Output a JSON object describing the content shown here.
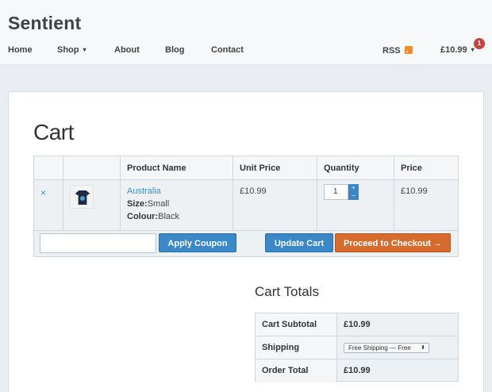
{
  "site": {
    "logo": "Sentient"
  },
  "nav": {
    "items": [
      {
        "label": "Home"
      },
      {
        "label": "Shop",
        "has_dropdown": true
      },
      {
        "label": "About"
      },
      {
        "label": "Blog"
      },
      {
        "label": "Contact"
      }
    ],
    "rss_label": "RSS",
    "cart_total": "£10.99",
    "cart_count": "1"
  },
  "page": {
    "title": "Cart"
  },
  "cart": {
    "columns": [
      "",
      "",
      "Product Name",
      "Unit Price",
      "Quantity",
      "Price"
    ],
    "items": [
      {
        "remove_symbol": "×",
        "product_name": "Australia",
        "size_label": "Size:",
        "size_value": "Small",
        "colour_label": "Colour:",
        "colour_value": "Black",
        "unit_price": "£10.99",
        "quantity": "1",
        "price": "£10.99"
      }
    ],
    "qty_up": "+",
    "qty_down": "−",
    "coupon_placeholder": "",
    "apply_coupon_label": "Apply Coupon",
    "update_cart_label": "Update Cart",
    "checkout_label": "Proceed to Checkout →"
  },
  "totals": {
    "title": "Cart Totals",
    "rows": [
      {
        "label": "Cart Subtotal",
        "value": "£10.99"
      },
      {
        "label": "Shipping",
        "value": "Free Shipping — Free"
      },
      {
        "label": "Order Total",
        "value": "£10.99"
      }
    ]
  },
  "colors": {
    "accent": "#3a88c7",
    "checkout": "#d76b2e",
    "link": "#3d8fcf",
    "badge": "#c84040"
  }
}
